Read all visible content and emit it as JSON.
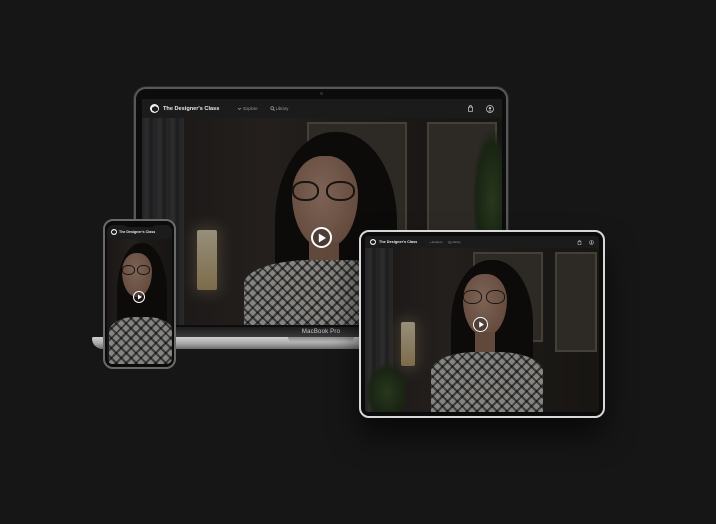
{
  "brand": {
    "name": "The Designer's Class"
  },
  "nav": {
    "explore": "Explore",
    "library": "Library"
  },
  "laptop": {
    "model_label": "MacBook Pro"
  },
  "icons": {
    "logo": "designers-class-logo",
    "explore": "chevron-down-icon",
    "library": "search-icon",
    "bag": "shopping-bag-icon",
    "account": "user-icon",
    "play": "play-icon"
  },
  "colors": {
    "background": "#161616",
    "appbar": "#1b1b1b",
    "text": "#e9e9e9"
  }
}
